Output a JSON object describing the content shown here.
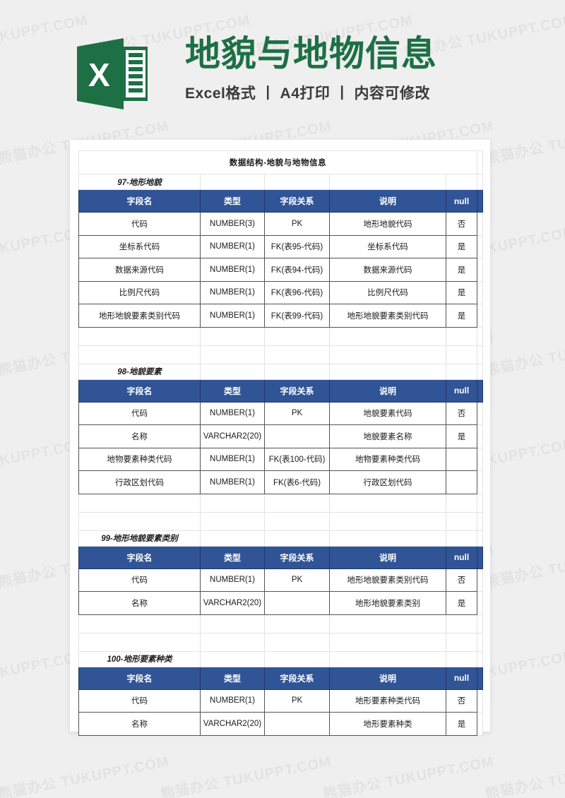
{
  "banner": {
    "logo_icon": "excel-logo-icon",
    "title": "地貌与地物信息",
    "subtitle": "Excel格式 丨 A4打印 丨 内容可修改",
    "title_color": "#1d7044",
    "subtitle_color": "#3a3a3a"
  },
  "watermark": {
    "text": "熊猫办公 TUKUPPT.COM"
  },
  "document": {
    "title": "数据结构-地貌与地物信息",
    "accent_color": "#305496",
    "columns": [
      "字段名",
      "类型",
      "字段关系",
      "说明",
      "null"
    ],
    "sections": [
      {
        "label": "97-地形地貌",
        "rows": [
          [
            "代码",
            "NUMBER(3)",
            "PK",
            "地形地貌代码",
            "否"
          ],
          [
            "坐标系代码",
            "NUMBER(1)",
            "FK(表95-代码)",
            "坐标系代码",
            "是"
          ],
          [
            "数据来源代码",
            "NUMBER(1)",
            "FK(表94-代码)",
            "数据来源代码",
            "是"
          ],
          [
            "比例尺代码",
            "NUMBER(1)",
            "FK(表96-代码)",
            "比例尺代码",
            "是"
          ],
          [
            "地形地貌要素类别代码",
            "NUMBER(1)",
            "FK(表99-代码)",
            "地形地貌要素类别代码",
            "是"
          ]
        ]
      },
      {
        "label": "98-地貌要素",
        "rows": [
          [
            "代码",
            "NUMBER(1)",
            "PK",
            "地貌要素代码",
            "否"
          ],
          [
            "名称",
            "VARCHAR2(20)",
            "",
            "地貌要素名称",
            "是"
          ],
          [
            "地物要素种类代码",
            "NUMBER(1)",
            "FK(表100-代码)",
            "地物要素种类代码",
            ""
          ],
          [
            "行政区划代码",
            "NUMBER(1)",
            "FK(表6-代码)",
            "行政区划代码",
            ""
          ]
        ]
      },
      {
        "label": "99-地形地貌要素类别",
        "rows": [
          [
            "代码",
            "NUMBER(1)",
            "PK",
            "地形地貌要素类别代码",
            "否"
          ],
          [
            "名称",
            "VARCHAR2(20)",
            "",
            "地形地貌要素类别",
            "是"
          ]
        ]
      },
      {
        "label": "100-地形要素种类",
        "rows": [
          [
            "代码",
            "NUMBER(1)",
            "PK",
            "地形要素种类代码",
            "否"
          ],
          [
            "名称",
            "VARCHAR2(20)",
            "",
            "地形要素种类",
            "是"
          ]
        ]
      }
    ]
  }
}
